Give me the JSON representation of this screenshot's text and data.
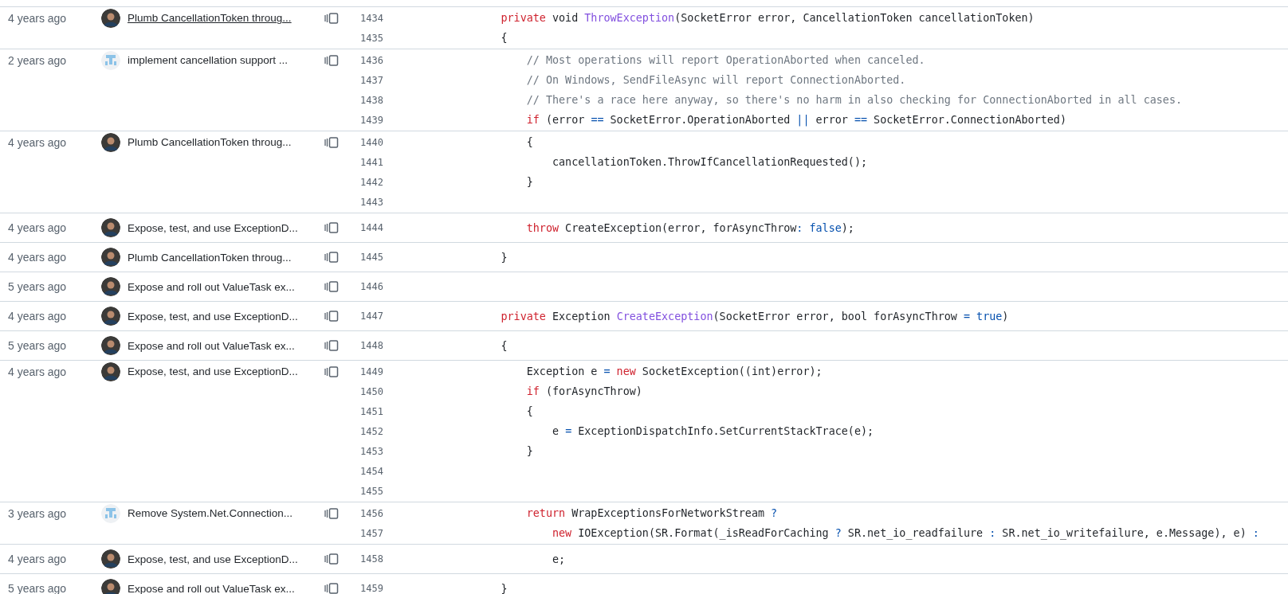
{
  "blame_groups": [
    {
      "age": "4 years ago",
      "avatar": {
        "kind": "photo"
      },
      "message": "Plumb CancellationToken throug...",
      "hovered": true,
      "lines": [
        {
          "number": "1434",
          "tokens": [
            {
              "kind": "keyword",
              "text": "        private"
            },
            {
              "kind": "plain",
              "text": " void "
            },
            {
              "kind": "func",
              "text": "ThrowException"
            },
            {
              "kind": "plain",
              "text": "(SocketError error, CancellationToken cancellationToken)"
            }
          ]
        },
        {
          "number": "1435",
          "tokens": [
            {
              "kind": "plain",
              "text": "        {"
            }
          ]
        }
      ]
    },
    {
      "age": "2 years ago",
      "avatar": {
        "kind": "identicon"
      },
      "message": "implement cancellation support ...",
      "hovered": false,
      "lines": [
        {
          "number": "1436",
          "tokens": [
            {
              "kind": "comment",
              "text": "            // Most operations will report OperationAborted when canceled."
            }
          ]
        },
        {
          "number": "1437",
          "tokens": [
            {
              "kind": "comment",
              "text": "            // On Windows, SendFileAsync will report ConnectionAborted."
            }
          ]
        },
        {
          "number": "1438",
          "tokens": [
            {
              "kind": "comment",
              "text": "            // There's a race here anyway, so there's no harm in also checking for ConnectionAborted in all cases."
            }
          ]
        },
        {
          "number": "1439",
          "tokens": [
            {
              "kind": "keyword",
              "text": "            if"
            },
            {
              "kind": "plain",
              "text": " (error "
            },
            {
              "kind": "operator",
              "text": "=="
            },
            {
              "kind": "plain",
              "text": " SocketError.OperationAborted "
            },
            {
              "kind": "operator",
              "text": "||"
            },
            {
              "kind": "plain",
              "text": " error "
            },
            {
              "kind": "operator",
              "text": "=="
            },
            {
              "kind": "plain",
              "text": " SocketError.ConnectionAborted)"
            }
          ]
        }
      ]
    },
    {
      "age": "4 years ago",
      "avatar": {
        "kind": "photo"
      },
      "message": "Plumb CancellationToken throug...",
      "hovered": false,
      "lines": [
        {
          "number": "1440",
          "tokens": [
            {
              "kind": "plain",
              "text": "            {"
            }
          ]
        },
        {
          "number": "1441",
          "tokens": [
            {
              "kind": "plain",
              "text": "                cancellationToken.ThrowIfCancellationRequested();"
            }
          ]
        },
        {
          "number": "1442",
          "tokens": [
            {
              "kind": "plain",
              "text": "            }"
            }
          ]
        },
        {
          "number": "1443"
        }
      ]
    },
    {
      "age": "4 years ago",
      "avatar": {
        "kind": "photo"
      },
      "message": "Expose, test, and use ExceptionD...",
      "hovered": false,
      "lines": [
        {
          "number": "1444",
          "tokens": [
            {
              "kind": "keyword",
              "text": "            throw"
            },
            {
              "kind": "plain",
              "text": " CreateException(error, forAsyncThrow"
            },
            {
              "kind": "operator",
              "text": ":"
            },
            {
              "kind": "operator",
              "text": " false"
            },
            {
              "kind": "plain",
              "text": ");"
            }
          ]
        }
      ]
    },
    {
      "age": "4 years ago",
      "avatar": {
        "kind": "photo"
      },
      "message": "Plumb CancellationToken throug...",
      "hovered": false,
      "lines": [
        {
          "number": "1445",
          "tokens": [
            {
              "kind": "plain",
              "text": "        }"
            }
          ]
        }
      ]
    },
    {
      "age": "5 years ago",
      "avatar": {
        "kind": "photo"
      },
      "message": "Expose and roll out ValueTask ex...",
      "hovered": false,
      "lines": [
        {
          "number": "1446"
        }
      ]
    },
    {
      "age": "4 years ago",
      "avatar": {
        "kind": "photo"
      },
      "message": "Expose, test, and use ExceptionD...",
      "hovered": false,
      "lines": [
        {
          "number": "1447",
          "tokens": [
            {
              "kind": "keyword",
              "text": "        private"
            },
            {
              "kind": "plain",
              "text": " Exception "
            },
            {
              "kind": "func",
              "text": "CreateException"
            },
            {
              "kind": "plain",
              "text": "(SocketError error, bool forAsyncThrow "
            },
            {
              "kind": "operator",
              "text": "= true"
            },
            {
              "kind": "plain",
              "text": ")"
            }
          ]
        }
      ]
    },
    {
      "age": "5 years ago",
      "avatar": {
        "kind": "photo"
      },
      "message": "Expose and roll out ValueTask ex...",
      "hovered": false,
      "lines": [
        {
          "number": "1448",
          "tokens": [
            {
              "kind": "plain",
              "text": "        {"
            }
          ]
        }
      ]
    },
    {
      "age": "4 years ago",
      "avatar": {
        "kind": "photo"
      },
      "message": "Expose, test, and use ExceptionD...",
      "hovered": false,
      "lines": [
        {
          "number": "1449",
          "tokens": [
            {
              "kind": "plain",
              "text": "            Exception e "
            },
            {
              "kind": "operator",
              "text": "="
            },
            {
              "kind": "keyword",
              "text": " new"
            },
            {
              "kind": "plain",
              "text": " SocketException((int)error);"
            }
          ]
        },
        {
          "number": "1450",
          "tokens": [
            {
              "kind": "keyword",
              "text": "            if"
            },
            {
              "kind": "plain",
              "text": " (forAsyncThrow)"
            }
          ]
        },
        {
          "number": "1451",
          "tokens": [
            {
              "kind": "plain",
              "text": "            {"
            }
          ]
        },
        {
          "number": "1452",
          "tokens": [
            {
              "kind": "plain",
              "text": "                e "
            },
            {
              "kind": "operator",
              "text": "="
            },
            {
              "kind": "plain",
              "text": " ExceptionDispatchInfo.SetCurrentStackTrace(e);"
            }
          ]
        },
        {
          "number": "1453",
          "tokens": [
            {
              "kind": "plain",
              "text": "            }"
            }
          ]
        },
        {
          "number": "1454"
        },
        {
          "number": "1455"
        }
      ]
    },
    {
      "age": "3 years ago",
      "avatar": {
        "kind": "identicon"
      },
      "message": "Remove System.Net.Connection...",
      "hovered": false,
      "lines": [
        {
          "number": "1456",
          "tokens": [
            {
              "kind": "keyword",
              "text": "            return"
            },
            {
              "kind": "plain",
              "text": " WrapExceptionsForNetworkStream "
            },
            {
              "kind": "operator",
              "text": "?"
            }
          ]
        },
        {
          "number": "1457",
          "tokens": [
            {
              "kind": "keyword",
              "text": "                new"
            },
            {
              "kind": "plain",
              "text": " IOException(SR.Format(_isReadForCaching "
            },
            {
              "kind": "operator",
              "text": "?"
            },
            {
              "kind": "plain",
              "text": " SR.net_io_readfailure "
            },
            {
              "kind": "operator",
              "text": ":"
            },
            {
              "kind": "plain",
              "text": " SR.net_io_writefailure, e.Message), e) "
            },
            {
              "kind": "operator",
              "text": ":"
            }
          ]
        }
      ]
    },
    {
      "age": "4 years ago",
      "avatar": {
        "kind": "photo"
      },
      "message": "Expose, test, and use ExceptionD...",
      "hovered": false,
      "lines": [
        {
          "number": "1458",
          "tokens": [
            {
              "kind": "plain",
              "text": "                e;"
            }
          ]
        }
      ]
    },
    {
      "age": "5 years ago",
      "avatar": {
        "kind": "photo"
      },
      "message": "Expose and roll out ValueTask ex...",
      "hovered": false,
      "lines": [
        {
          "number": "1459",
          "tokens": [
            {
              "kind": "plain",
              "text": "        }"
            }
          ]
        }
      ]
    }
  ]
}
